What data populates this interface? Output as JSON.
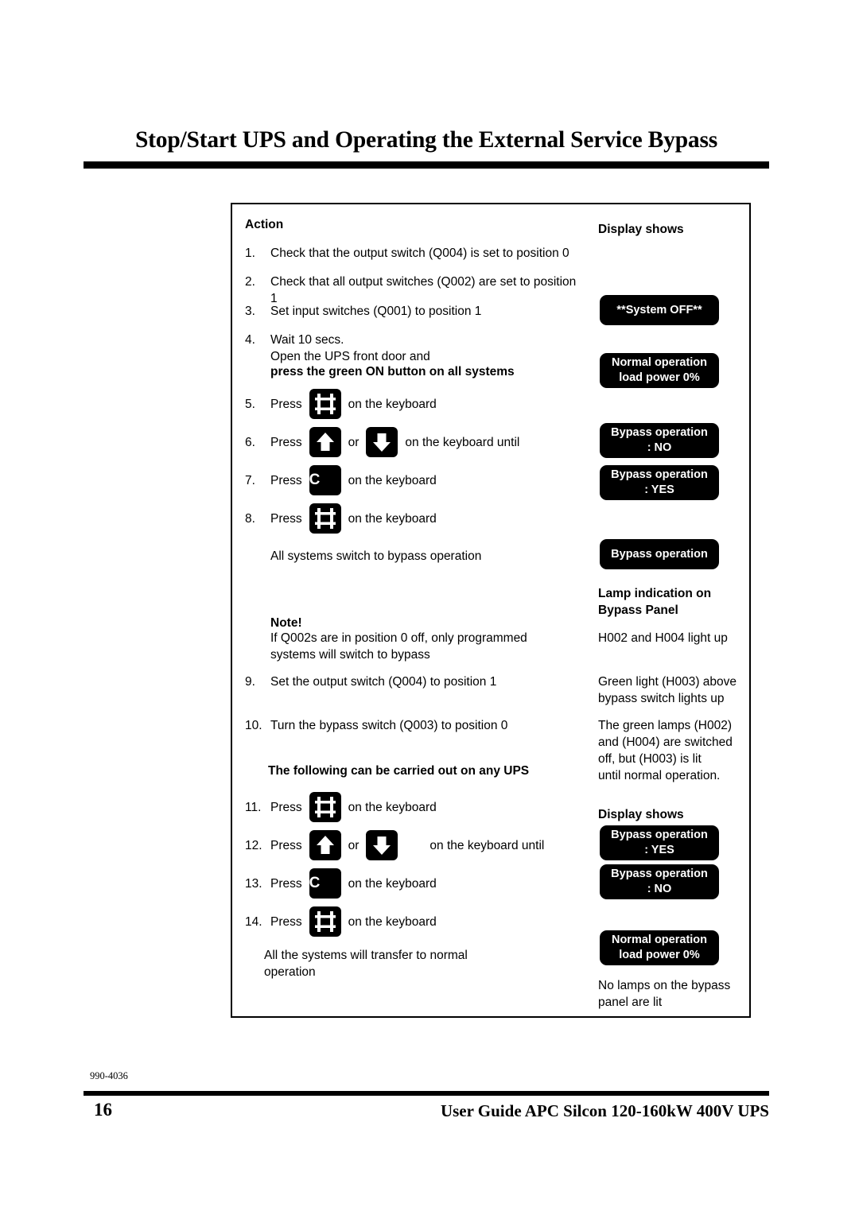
{
  "page": {
    "title": "Stop/Start UPS and Operating the External Service Bypass",
    "doc_code": "990-4036",
    "page_number": "16",
    "footer_title": "User Guide APC Silcon 120-160kW 400V UPS"
  },
  "columns": {
    "action_heading": "Action",
    "display_heading_1": "Display shows",
    "lamp_heading": "Lamp indication on\nBypass Panel",
    "display_heading_2": "Display shows"
  },
  "steps": [
    {
      "num": "1.",
      "text": "Check that the output switch (Q004) is set to position 0"
    },
    {
      "num": "2.",
      "text": "Check that all output switches (Q002) are set to position 1"
    },
    {
      "num": "3.",
      "text": "Set input switches (Q001) to position 1"
    },
    {
      "num": "4.",
      "text": "Wait 10 secs.\nOpen the UPS front door and"
    },
    {
      "num": "9.",
      "text": "Set the output switch (Q004) to position 1"
    },
    {
      "num": "10.",
      "text": "Turn the bypass switch (Q003) to position 0"
    }
  ],
  "step4_bold": "press the green ON button on all systems",
  "key_steps": [
    {
      "num": "5.",
      "press": "Press",
      "key1": "frame",
      "tail": "on the keyboard"
    },
    {
      "num": "6.",
      "press": "Press",
      "key1": "arrow-up",
      "mid": "or",
      "key2": "arrow-down",
      "tail": "on the keyboard until"
    },
    {
      "num": "7.",
      "press": "Press",
      "key1": "c",
      "tail": "on the keyboard"
    },
    {
      "num": "8.",
      "press": "Press",
      "key1": "frame",
      "tail": "on the keyboard"
    },
    {
      "num": "11.",
      "press": "Press",
      "key1": "frame",
      "tail": "on the keyboard"
    },
    {
      "num": "12.",
      "press": "Press",
      "key1": "arrow-up",
      "mid": "or",
      "key2": "arrow-down",
      "tail": "on the keyboard until"
    },
    {
      "num": "13.",
      "press": "Press",
      "key1": "c",
      "tail": "on the keyboard"
    },
    {
      "num": "14.",
      "press": "Press",
      "key1": "frame",
      "tail": "on the keyboard"
    }
  ],
  "notes": {
    "bypass_result_1": "All systems switch to bypass operation",
    "note_heading": "Note!",
    "note_body": "If Q002s are in position 0 off, only programmed\nsystems will switch to bypass",
    "any_ups_heading": "The following can be carried out on any UPS",
    "normal_result": "All the systems will transfer to normal\noperation"
  },
  "displays": [
    {
      "id": "system-off",
      "text": "**System OFF**"
    },
    {
      "id": "normal-operation-0",
      "text": "Normal operation\nload power 0%"
    },
    {
      "id": "bypass-no-1",
      "text": "Bypass operation\n:  NO"
    },
    {
      "id": "bypass-yes-1",
      "text": "Bypass operation\n:  YES"
    },
    {
      "id": "bypass-operation",
      "text": "Bypass operation"
    },
    {
      "id": "bypass-yes-2",
      "text": "Bypass operation\n:  YES"
    },
    {
      "id": "bypass-no-2",
      "text": "Bypass operation\n:  NO"
    },
    {
      "id": "normal-operation-1",
      "text": "Normal operation\nload power 0%"
    }
  ],
  "lamp_texts": {
    "h002_h004": "H002 and H004 light up",
    "h003_green": "Green light (H003) above\nbypass switch lights up",
    "h003_lit": "The green lamps (H002)\nand (H004) are switched\noff, but (H003) is lit\nuntil normal operation.",
    "no_lamps": "No lamps on the bypass\npanel are lit"
  },
  "colors": {
    "ink": "#000000",
    "paper": "#ffffff",
    "display_bg": "#000000",
    "display_fg": "#ffffff"
  }
}
